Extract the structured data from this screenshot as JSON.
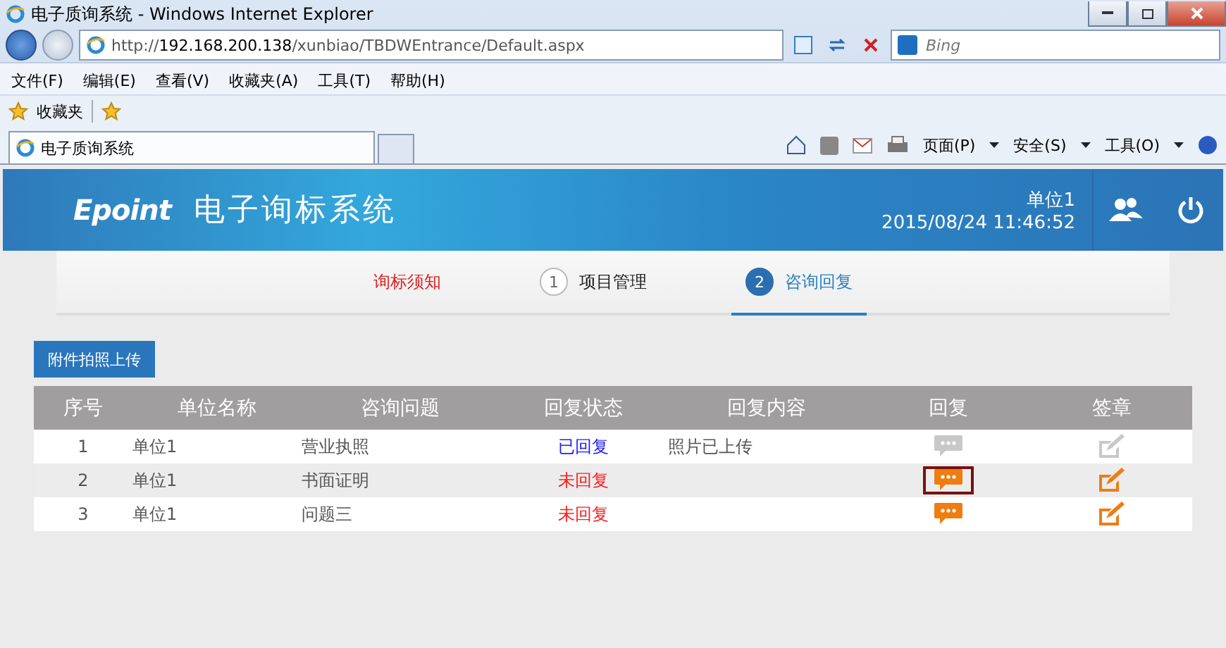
{
  "window": {
    "title": "电子质询系统 - Windows Internet Explorer"
  },
  "address": {
    "url_prefix": "http://",
    "url_host": "192.168.200.138",
    "url_path": "/xunbiao/TBDWEntrance/Default.aspx",
    "search_placeholder": "Bing"
  },
  "menu": [
    "文件(F)",
    "编辑(E)",
    "查看(V)",
    "收藏夹(A)",
    "工具(T)",
    "帮助(H)"
  ],
  "favorites": {
    "label": "收藏夹"
  },
  "tab": {
    "title": "电子质询系统"
  },
  "command_bar": [
    "页面(P)",
    "安全(S)",
    "工具(O)"
  ],
  "app": {
    "logo": "Epoint",
    "title": "电子询标系统",
    "user": "单位1",
    "datetime": "2015/08/24 11:46:52"
  },
  "steps": [
    {
      "label": "询标须知",
      "kind": "notice",
      "selected": false
    },
    {
      "number": "1",
      "label": "项目管理",
      "kind": "numbered",
      "selected": false
    },
    {
      "number": "2",
      "label": "咨询回复",
      "kind": "numbered",
      "selected": true
    }
  ],
  "upload_button": "附件拍照上传",
  "table": {
    "columns": [
      "序号",
      "单位名称",
      "咨询问题",
      "回复状态",
      "回复内容",
      "回复",
      "签章"
    ],
    "rows": [
      {
        "index": "1",
        "unit": "单位1",
        "question": "营业执照",
        "status": "已回复",
        "replied": true,
        "content": "照片已上传",
        "reply_enabled": false,
        "sign_enabled": false,
        "focused": false
      },
      {
        "index": "2",
        "unit": "单位1",
        "question": "书面证明",
        "status": "未回复",
        "replied": false,
        "reply_enabled": true,
        "sign_enabled": true,
        "focused": true
      },
      {
        "index": "3",
        "unit": "单位1",
        "question": "问题三",
        "status": "未回复",
        "replied": false,
        "reply_enabled": true,
        "sign_enabled": true,
        "focused": false
      }
    ]
  }
}
